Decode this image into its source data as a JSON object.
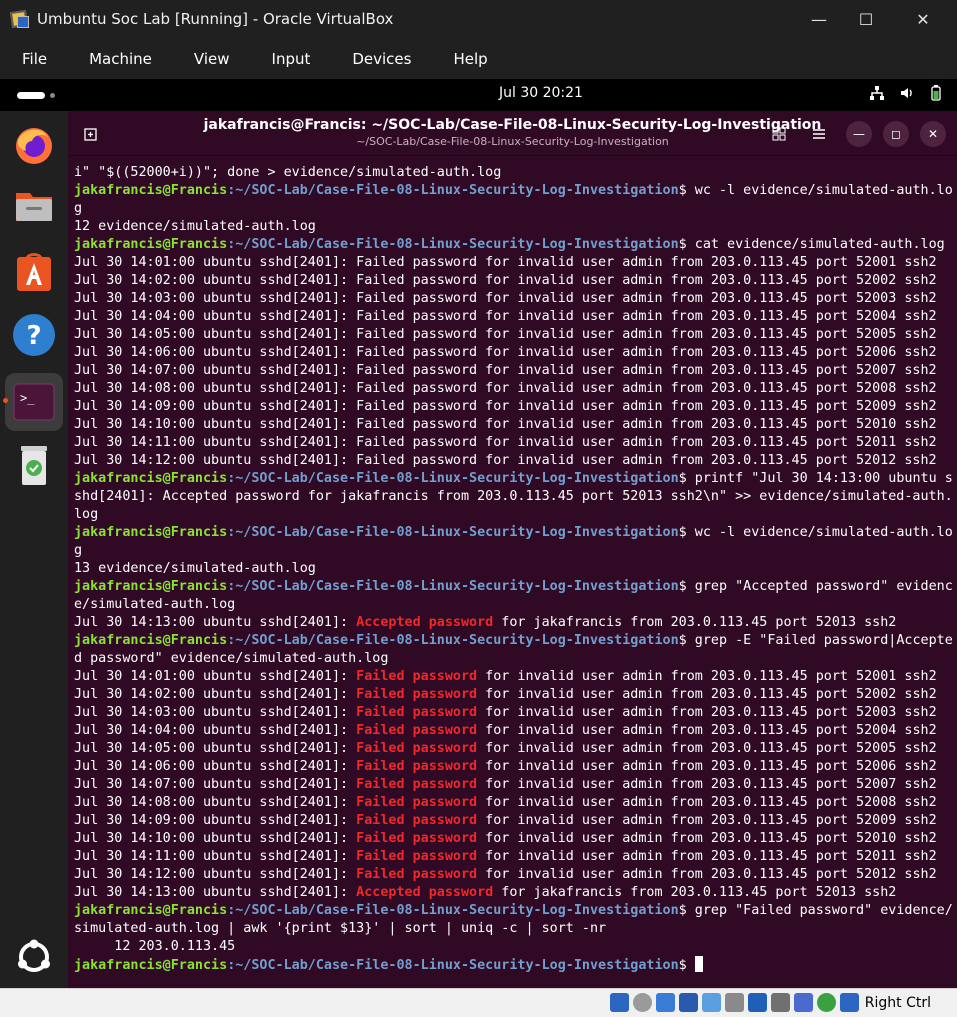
{
  "window": {
    "title": "Umbuntu Soc Lab [Running] - Oracle VirtualBox",
    "menu": [
      "File",
      "Machine",
      "View",
      "Input",
      "Devices",
      "Help"
    ]
  },
  "topbar": {
    "clock": "Jul 30  20:21"
  },
  "dock": {
    "items": [
      "firefox-icon",
      "files-icon",
      "app-center-icon",
      "help-icon",
      "terminal-icon",
      "trash-icon"
    ],
    "show_apps": "show-apps-icon"
  },
  "terminal": {
    "title": "jakafrancis@Francis: ~/SOC-Lab/Case-File-08-Linux-Security-Log-Investigation",
    "subtitle": "~/SOC-Lab/Case-File-08-Linux-Security-Log-Investigation",
    "prompt_user": "jakafrancis@Francis",
    "prompt_path": ":~/SOC-Lab/Case-File-08-Linux-Security-Log-Investigation",
    "lines": [
      {
        "text": "i\" \"$((52000+i))\"; done > evidence/simulated-auth.log"
      },
      {
        "prompt": true,
        "text": "$ wc -l evidence/simulated-auth.lo"
      },
      {
        "text": "g"
      },
      {
        "text": "12 evidence/simulated-auth.log"
      },
      {
        "prompt": true,
        "text": "$ cat evidence/simulated-auth.log"
      },
      {
        "text": "Jul 30 14:01:00 ubuntu sshd[2401]: Failed password for invalid user admin from 203.0.113.45 port 52001 ssh2"
      },
      {
        "text": "Jul 30 14:02:00 ubuntu sshd[2401]: Failed password for invalid user admin from 203.0.113.45 port 52002 ssh2"
      },
      {
        "text": "Jul 30 14:03:00 ubuntu sshd[2401]: Failed password for invalid user admin from 203.0.113.45 port 52003 ssh2"
      },
      {
        "text": "Jul 30 14:04:00 ubuntu sshd[2401]: Failed password for invalid user admin from 203.0.113.45 port 52004 ssh2"
      },
      {
        "text": "Jul 30 14:05:00 ubuntu sshd[2401]: Failed password for invalid user admin from 203.0.113.45 port 52005 ssh2"
      },
      {
        "text": "Jul 30 14:06:00 ubuntu sshd[2401]: Failed password for invalid user admin from 203.0.113.45 port 52006 ssh2"
      },
      {
        "text": "Jul 30 14:07:00 ubuntu sshd[2401]: Failed password for invalid user admin from 203.0.113.45 port 52007 ssh2"
      },
      {
        "text": "Jul 30 14:08:00 ubuntu sshd[2401]: Failed password for invalid user admin from 203.0.113.45 port 52008 ssh2"
      },
      {
        "text": "Jul 30 14:09:00 ubuntu sshd[2401]: Failed password for invalid user admin from 203.0.113.45 port 52009 ssh2"
      },
      {
        "text": "Jul 30 14:10:00 ubuntu sshd[2401]: Failed password for invalid user admin from 203.0.113.45 port 52010 ssh2"
      },
      {
        "text": "Jul 30 14:11:00 ubuntu sshd[2401]: Failed password for invalid user admin from 203.0.113.45 port 52011 ssh2"
      },
      {
        "text": "Jul 30 14:12:00 ubuntu sshd[2401]: Failed password for invalid user admin from 203.0.113.45 port 52012 ssh2"
      },
      {
        "prompt": true,
        "text": "$ printf \"Jul 30 14:13:00 ubuntu s"
      },
      {
        "text": "shd[2401]: Accepted password for jakafrancis from 203.0.113.45 port 52013 ssh2\\n\" >> evidence/simulated-auth."
      },
      {
        "text": "log"
      },
      {
        "prompt": true,
        "text": "$ wc -l evidence/simulated-auth.lo"
      },
      {
        "text": "g"
      },
      {
        "text": "13 evidence/simulated-auth.log"
      },
      {
        "prompt": true,
        "text": "$ grep \"Accepted password\" evidenc"
      },
      {
        "text": "e/simulated-auth.log"
      },
      {
        "pre": "Jul 30 14:13:00 ubuntu sshd[2401]: ",
        "hl": "Accepted password",
        "post": " for jakafrancis from 203.0.113.45 port 52013 ssh2"
      },
      {
        "prompt": true,
        "text": "$ grep -E \"Failed password|Accepte"
      },
      {
        "text": "d password\" evidence/simulated-auth.log"
      },
      {
        "pre": "Jul 30 14:01:00 ubuntu sshd[2401]: ",
        "hl": "Failed password",
        "post": " for invalid user admin from 203.0.113.45 port 52001 ssh2"
      },
      {
        "pre": "Jul 30 14:02:00 ubuntu sshd[2401]: ",
        "hl": "Failed password",
        "post": " for invalid user admin from 203.0.113.45 port 52002 ssh2"
      },
      {
        "pre": "Jul 30 14:03:00 ubuntu sshd[2401]: ",
        "hl": "Failed password",
        "post": " for invalid user admin from 203.0.113.45 port 52003 ssh2"
      },
      {
        "pre": "Jul 30 14:04:00 ubuntu sshd[2401]: ",
        "hl": "Failed password",
        "post": " for invalid user admin from 203.0.113.45 port 52004 ssh2"
      },
      {
        "pre": "Jul 30 14:05:00 ubuntu sshd[2401]: ",
        "hl": "Failed password",
        "post": " for invalid user admin from 203.0.113.45 port 52005 ssh2"
      },
      {
        "pre": "Jul 30 14:06:00 ubuntu sshd[2401]: ",
        "hl": "Failed password",
        "post": " for invalid user admin from 203.0.113.45 port 52006 ssh2"
      },
      {
        "pre": "Jul 30 14:07:00 ubuntu sshd[2401]: ",
        "hl": "Failed password",
        "post": " for invalid user admin from 203.0.113.45 port 52007 ssh2"
      },
      {
        "pre": "Jul 30 14:08:00 ubuntu sshd[2401]: ",
        "hl": "Failed password",
        "post": " for invalid user admin from 203.0.113.45 port 52008 ssh2"
      },
      {
        "pre": "Jul 30 14:09:00 ubuntu sshd[2401]: ",
        "hl": "Failed password",
        "post": " for invalid user admin from 203.0.113.45 port 52009 ssh2"
      },
      {
        "pre": "Jul 30 14:10:00 ubuntu sshd[2401]: ",
        "hl": "Failed password",
        "post": " for invalid user admin from 203.0.113.45 port 52010 ssh2"
      },
      {
        "pre": "Jul 30 14:11:00 ubuntu sshd[2401]: ",
        "hl": "Failed password",
        "post": " for invalid user admin from 203.0.113.45 port 52011 ssh2"
      },
      {
        "pre": "Jul 30 14:12:00 ubuntu sshd[2401]: ",
        "hl": "Failed password",
        "post": " for invalid user admin from 203.0.113.45 port 52012 ssh2"
      },
      {
        "pre": "Jul 30 14:13:00 ubuntu sshd[2401]: ",
        "hl": "Accepted password",
        "post": " for jakafrancis from 203.0.113.45 port 52013 ssh2"
      },
      {
        "prompt": true,
        "text": "$ grep \"Failed password\" evidence/"
      },
      {
        "text": "simulated-auth.log | awk '{print $13}' | sort | uniq -c | sort -nr"
      },
      {
        "text": "     12 203.0.113.45"
      },
      {
        "prompt": true,
        "text": "$ ",
        "cursor": true
      }
    ]
  },
  "statusbar": {
    "host_key": "Right Ctrl"
  }
}
